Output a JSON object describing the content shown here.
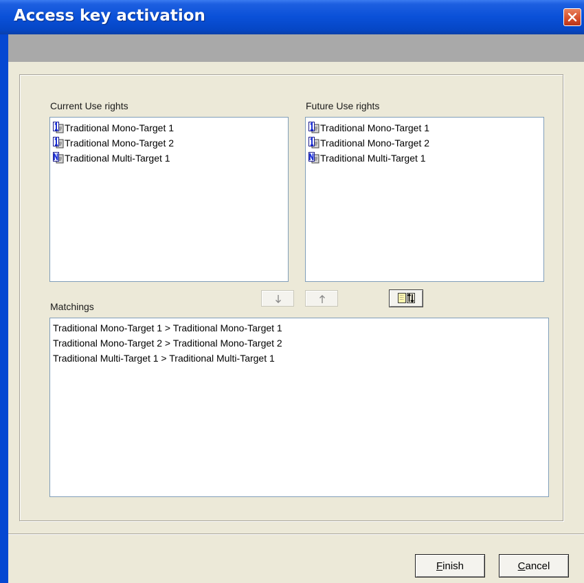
{
  "window": {
    "title": "Access key activation",
    "title_color": "#0a50d8",
    "close_icon": "close-x-icon"
  },
  "current_use": {
    "label": "Current Use rights",
    "items": [
      {
        "icon": "mono-target-icon",
        "label": "Traditional Mono-Target 1"
      },
      {
        "icon": "mono-target-icon",
        "label": "Traditional Mono-Target 2"
      },
      {
        "icon": "multi-target-icon",
        "label": "Traditional Multi-Target 1"
      }
    ]
  },
  "future_use": {
    "label": "Future Use rights",
    "items": [
      {
        "icon": "mono-target-icon",
        "label": "Traditional Mono-Target 1"
      },
      {
        "icon": "mono-target-icon",
        "label": "Traditional Mono-Target 2"
      },
      {
        "icon": "multi-target-icon",
        "label": "Traditional Multi-Target 1"
      }
    ]
  },
  "toolbar": {
    "down_icon": "arrow-down-icon",
    "up_icon": "arrow-up-icon",
    "swap_icon": "match-swap-icon"
  },
  "matchings": {
    "label": "Matchings",
    "items": [
      "Traditional Mono-Target 1 > Traditional Mono-Target 1",
      "Traditional Mono-Target 2 > Traditional Mono-Target 2",
      "Traditional Multi-Target 1 > Traditional Multi-Target 1"
    ]
  },
  "buttons": {
    "finish_mnemonic": "F",
    "finish_rest": "inish",
    "cancel_mnemonic": "C",
    "cancel_rest": "ancel"
  }
}
